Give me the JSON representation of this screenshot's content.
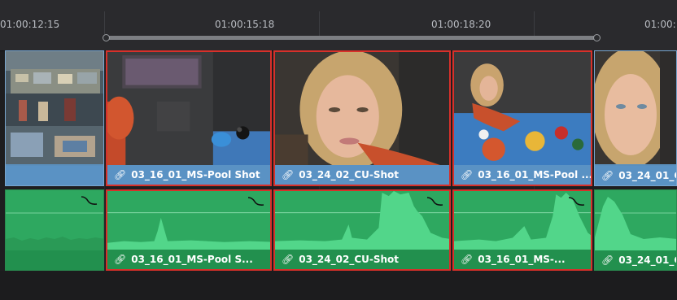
{
  "ruler": {
    "timecodes": [
      "01:00:12:15",
      "01:00:15:18",
      "01:00:18:20",
      "01:00:"
    ]
  },
  "video_clips": [
    {
      "label": "",
      "selected": false
    },
    {
      "label": "03_16_01_MS-Pool Shot",
      "selected": true
    },
    {
      "label": "03_24_02_CU-Shot",
      "selected": true
    },
    {
      "label": "03_16_01_MS-Pool ...",
      "selected": true
    },
    {
      "label": "03_24_01_C",
      "selected": false
    }
  ],
  "audio_clips": [
    {
      "label": "",
      "selected": false
    },
    {
      "label": "03_16_01_MS-Pool S...",
      "selected": true
    },
    {
      "label": "03_24_02_CU-Shot",
      "selected": true
    },
    {
      "label": "03_16_01_MS-...",
      "selected": true
    },
    {
      "label": "03_24_01_C",
      "selected": false
    }
  ],
  "icons": {
    "link": "link-icon",
    "fade": "audio-fade-icon"
  },
  "colors": {
    "selection": "#d8302a",
    "video_clip": "#5a92c4",
    "audio_clip": "#2ea860"
  }
}
